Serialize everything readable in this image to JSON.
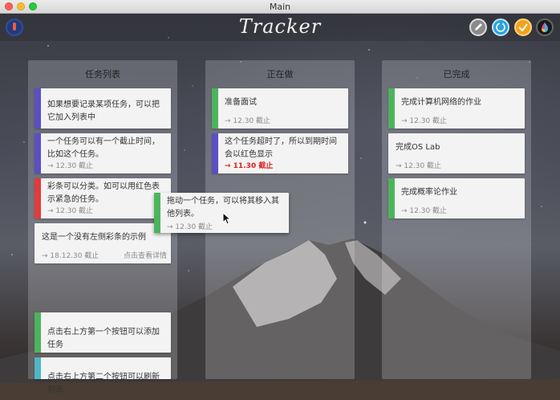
{
  "window": {
    "title": "Main"
  },
  "app": {
    "title": "Tracker",
    "header_buttons": [
      {
        "name": "pencil-icon",
        "color": "#8a8a8a"
      },
      {
        "name": "refresh-icon",
        "color": "#2ba3e0"
      },
      {
        "name": "check-icon",
        "color": "#f3a21b"
      },
      {
        "name": "color-drop-icon",
        "color": "#1a1a1a"
      }
    ]
  },
  "colors": {
    "purple": "#5b4fc4",
    "red": "#e23b3b",
    "green": "#4cb45c",
    "teal": "#4fb6c6"
  },
  "columns": [
    {
      "title": "任务列表",
      "cards": [
        {
          "text": "如果想要记录某项任务，可以把它加入列表中",
          "meta": "",
          "bar": "purple"
        },
        {
          "text": "一个任务可以有一个截止时间，比如这个任务。",
          "meta": "→ 12.30  截止",
          "bar": "purple"
        },
        {
          "text": "彩条可以分类。如可以用红色表示紧急的任务。",
          "meta": "→ 12.30  截止",
          "bar": "red"
        },
        {
          "text": "这是一个没有左侧彩条的示例",
          "meta": "→ 18.12.30  截止",
          "detail": "点击查看详情",
          "bar": ""
        },
        {
          "text": "点击右上方第一个按钮可以添加任务",
          "meta": "",
          "bar": "green"
        },
        {
          "text": "点击右上方第二个按钮可以刷新列表",
          "meta": "",
          "bar": "teal"
        }
      ]
    },
    {
      "title": "正在做",
      "cards": [
        {
          "text": "准备面试",
          "meta": "→ 12.30  截止",
          "bar": "green"
        },
        {
          "text": "这个任务超时了，所以到期时间会以红色显示",
          "meta": "→ 11.30  截止",
          "late": true,
          "bar": "purple"
        }
      ]
    },
    {
      "title": "已完成",
      "cards": [
        {
          "text": "完成计算机网络的作业",
          "meta": "→ 12.30  截止",
          "bar": "green"
        },
        {
          "text": "完成OS Lab",
          "meta": "→ 12.30  截止",
          "bar": ""
        },
        {
          "text": "完成概率论作业",
          "meta": "→ 12.30  截止",
          "bar": "green"
        }
      ]
    }
  ],
  "dragging_card": {
    "text": "拖动一个任务，可以将其移入其他列表。",
    "meta": "→ 12.30  截止"
  }
}
